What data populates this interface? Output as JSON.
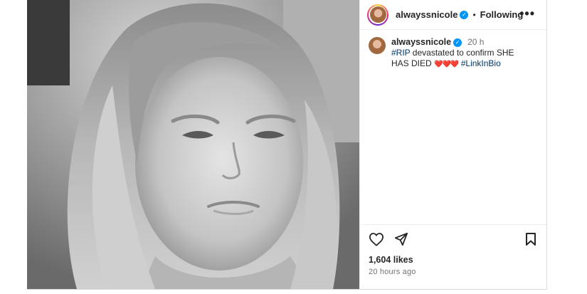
{
  "post": {
    "author": "alwayssnicole",
    "follow_status": "Following",
    "separator": "•",
    "more_glyph": "•••",
    "media_alt": "black and white close-up photo of a young woman with long blonde hair",
    "caption": {
      "author": "alwayssnicole",
      "time": "20 h",
      "hashtag_rip": "#RIP",
      "text_1": " devastated to confirm SHE HAS DIED ",
      "hearts": "❤️❤️❤️",
      "hashtag_link": "#LinkInBio"
    },
    "likes": "1,604 likes",
    "posted_ago": "20 hours ago",
    "icons": {
      "like": "heart-outline-icon",
      "share": "paper-plane-icon",
      "save": "bookmark-icon",
      "verified": "verified-badge-icon"
    }
  }
}
